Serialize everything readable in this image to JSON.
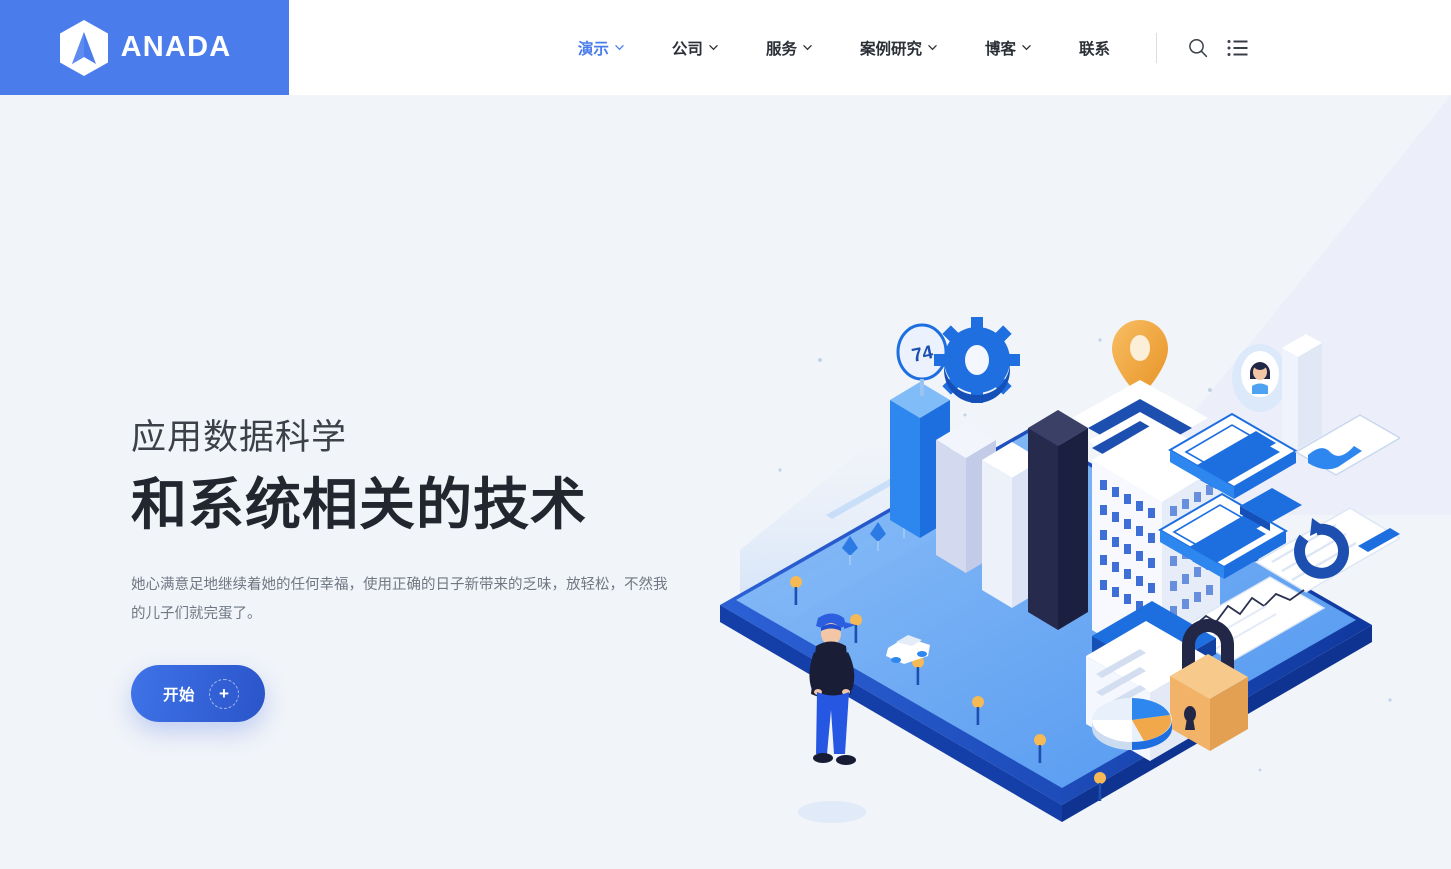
{
  "brand": {
    "name": "ANADA",
    "logo_icon": "hexagon-a-logo-icon",
    "background_color": "#4A7CEC"
  },
  "nav": {
    "items": [
      {
        "label": "演示",
        "has_caret": true,
        "active": true
      },
      {
        "label": "公司",
        "has_caret": true,
        "active": false
      },
      {
        "label": "服务",
        "has_caret": true,
        "active": false
      },
      {
        "label": "案例研究",
        "has_caret": true,
        "active": false
      },
      {
        "label": "博客",
        "has_caret": true,
        "active": false
      },
      {
        "label": "联系",
        "has_caret": false,
        "active": false
      }
    ],
    "search_icon": "search-icon",
    "menu_icon": "list-menu-icon",
    "active_color": "#4A7CEC",
    "text_color": "#2B2F36"
  },
  "hero": {
    "subtitle": "应用数据科学",
    "title": "和系统相关的技术",
    "paragraph": "她心满意足地继续着她的任何幸福，使用正确的日子新带来的乏味，放轻松，不然我的儿子们就完蛋了。",
    "cta_label": "开始",
    "cta_icon": "plus-icon",
    "cta_color_start": "#3F73E8",
    "cta_color_end": "#2A55C9"
  },
  "illustration": {
    "name": "isometric-smart-city-data-platform",
    "clock_badge": "74",
    "elements": [
      "isometric-platform",
      "bar-chart-columns",
      "office-tower",
      "gear-icon",
      "location-pin-icon",
      "clock-74-icon",
      "avatar-bubble",
      "dashboard-cards",
      "refresh-icon",
      "padlock-icon",
      "pie-chart",
      "line-chart-panel",
      "street-lamps",
      "white-car",
      "trees",
      "standing-person"
    ],
    "colors": {
      "platform_top": "#64A4F3",
      "platform_rim": "#1B4BC4",
      "accent_blue": "#1D6FE0",
      "dark_navy": "#232747",
      "orange": "#F0A84B",
      "light": "#FFFFFF"
    }
  },
  "page": {
    "background_color": "#F1F4F9",
    "header_background": "#FFFFFF"
  }
}
